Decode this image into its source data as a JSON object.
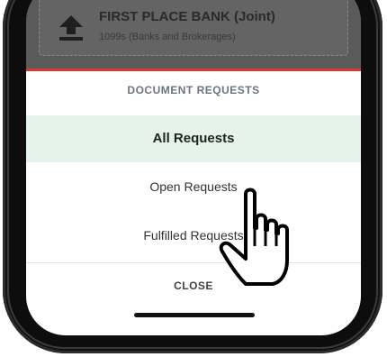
{
  "background_card": {
    "title": "FIRST PLACE BANK  (Joint)",
    "subtitle": "1099s (Banks and Brokerages)",
    "icon": "upload-icon"
  },
  "sheet": {
    "title": "DOCUMENT REQUESTS",
    "options": [
      {
        "label": "All Requests",
        "selected": true
      },
      {
        "label": "Open Requests",
        "selected": false
      },
      {
        "label": "Fulfilled Requests",
        "selected": false
      }
    ],
    "close_label": "CLOSE",
    "accent_color": "#d63a2f",
    "selected_bg": "#e6f3eb"
  },
  "cursor": {
    "icon": "pointing-hand-icon"
  }
}
